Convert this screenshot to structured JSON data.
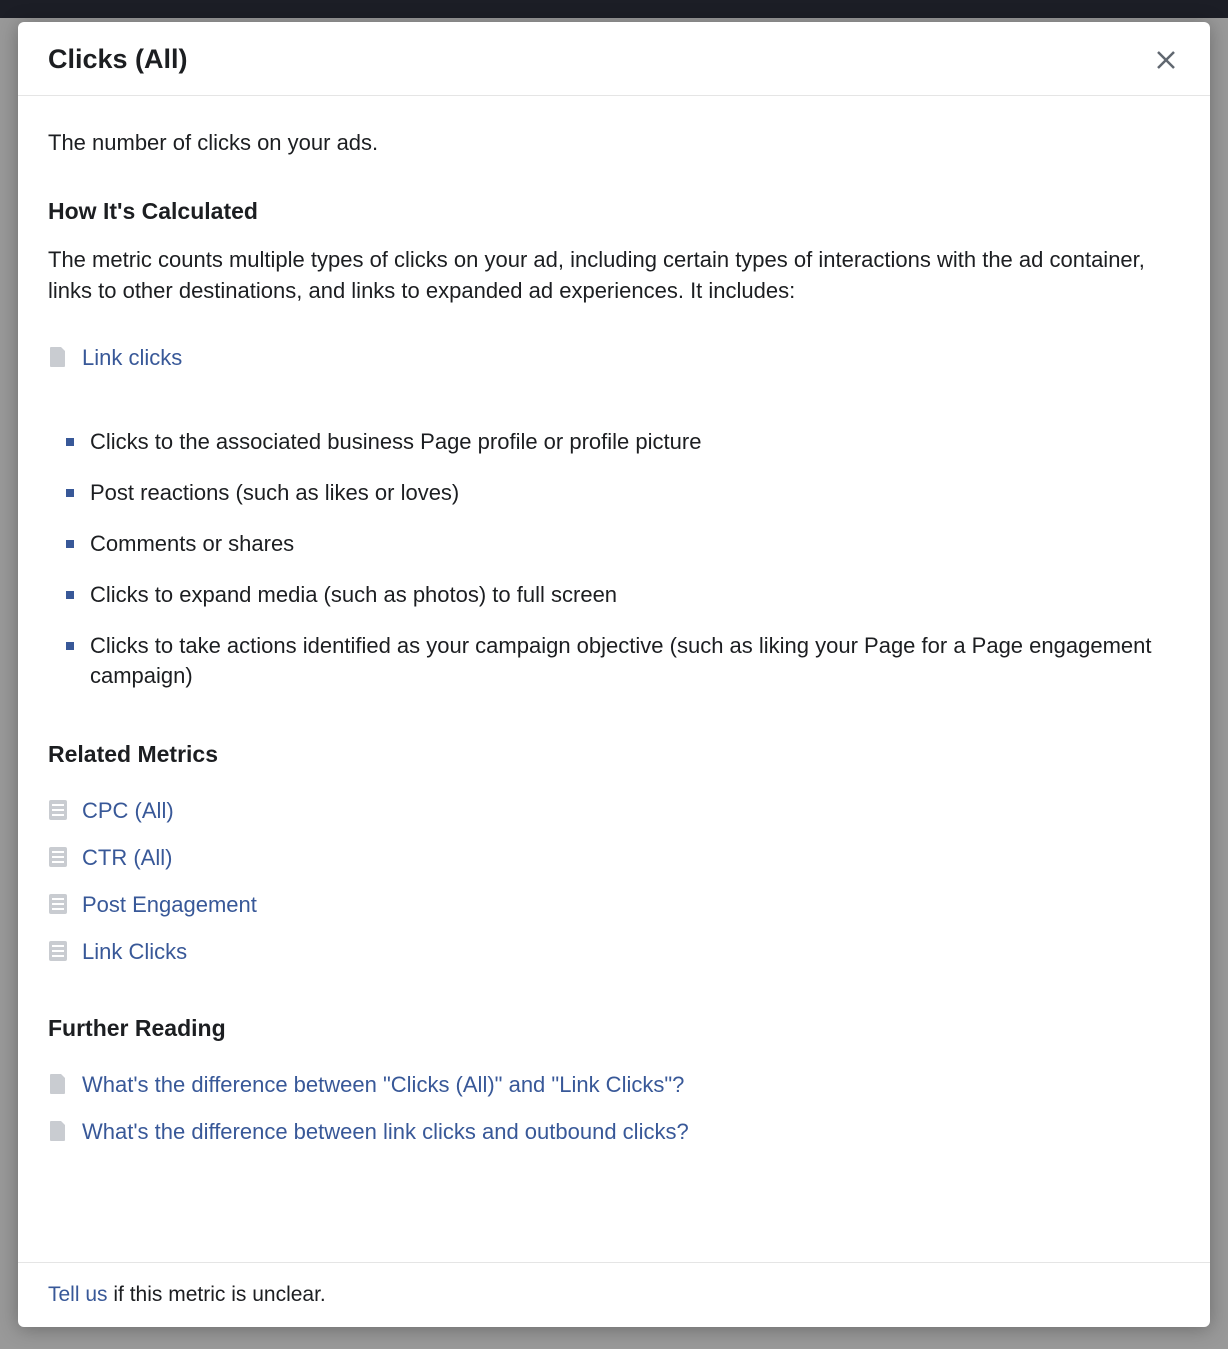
{
  "modal": {
    "title": "Clicks (All)",
    "intro": "The number of clicks on your ads.",
    "sections": {
      "calculated": {
        "heading": "How It's Calculated",
        "paragraph": "The metric counts multiple types of clicks on your ad, including certain types of interactions with the ad container, links to other destinations, and links to expanded ad experiences. It includes:",
        "first_link": "Link clicks",
        "bullets": [
          "Clicks to the associated business Page profile or profile picture",
          "Post reactions (such as likes or loves)",
          "Comments or shares",
          "Clicks to expand media (such as photos) to full screen",
          "Clicks to take actions identified as your campaign objective (such as liking your Page for a Page engagement campaign)"
        ]
      },
      "related": {
        "heading": "Related Metrics",
        "items": [
          "CPC (All)",
          "CTR (All)",
          "Post Engagement",
          "Link Clicks"
        ]
      },
      "reading": {
        "heading": "Further Reading",
        "items": [
          "What's the difference between \"Clicks (All)\" and \"Link Clicks\"?",
          "What's the difference between link clicks and outbound clicks?"
        ]
      }
    },
    "footer": {
      "link_text": "Tell us",
      "rest": " if this metric is unclear."
    }
  }
}
